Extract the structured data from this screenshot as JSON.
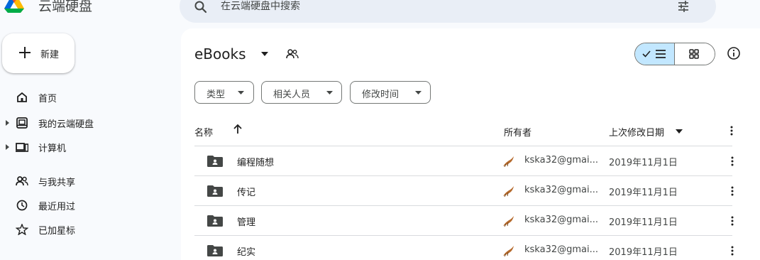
{
  "app": {
    "title": "云端硬盘"
  },
  "search": {
    "placeholder": "在云端硬盘中搜索"
  },
  "sidebar": {
    "new_label": "新建",
    "items": [
      {
        "label": "首页",
        "icon": "home-icon"
      },
      {
        "label": "我的云端硬盘",
        "icon": "my-drive-icon"
      },
      {
        "label": "计算机",
        "icon": "computer-icon"
      },
      {
        "label": "与我共享",
        "icon": "shared-icon"
      },
      {
        "label": "最近用过",
        "icon": "clock-icon"
      },
      {
        "label": "已加星标",
        "icon": "star-icon"
      }
    ]
  },
  "main": {
    "folder_title": "eBooks",
    "filters": [
      {
        "label": "类型"
      },
      {
        "label": "相关人员"
      },
      {
        "label": "修改时间"
      }
    ],
    "columns": {
      "name": "名称",
      "owner": "所有者",
      "modified": "上次修改日期"
    },
    "rows": [
      {
        "name": "编程随想",
        "owner": "kska32@gmai...",
        "date": "2019年11月1日"
      },
      {
        "name": "传记",
        "owner": "kska32@gmai...",
        "date": "2019年11月1日"
      },
      {
        "name": "管理",
        "owner": "kska32@gmai...",
        "date": "2019年11月1日"
      },
      {
        "name": "纪实",
        "owner": "kska32@gmai...",
        "date": "2019年11月1日"
      }
    ]
  },
  "colors": {
    "background": "#f8fafd",
    "surface": "#ffffff",
    "search_bg": "#e9eef6",
    "toggle_active": "#c2e7ff",
    "text_primary": "#1f1f1f",
    "text_secondary": "#444746"
  }
}
